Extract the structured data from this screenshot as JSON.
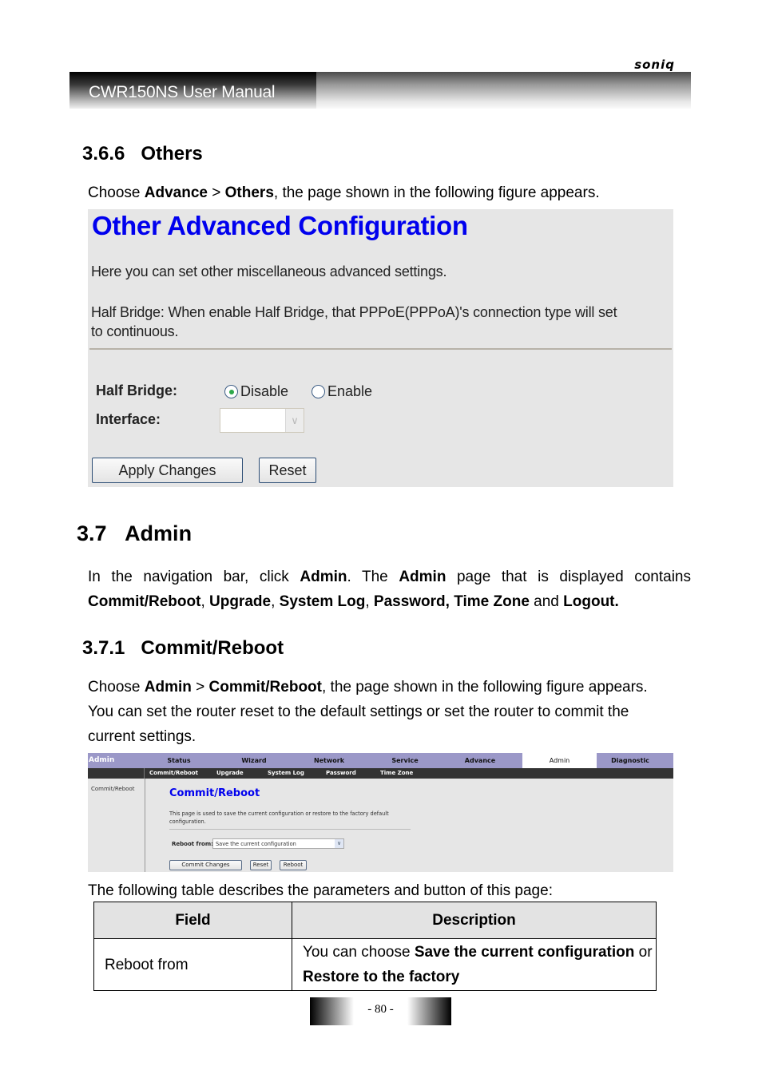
{
  "header": {
    "brand": "soniq",
    "manual_title": "CWR150NS User Manual"
  },
  "section_366": {
    "number": "3.6.6",
    "title": "Others",
    "intro": {
      "pre": "Choose ",
      "b1": "Advance",
      "mid": " > ",
      "b2": "Others",
      "post": ", the page shown in the following figure appears."
    }
  },
  "others_screen": {
    "title": "Other Advanced Configuration",
    "desc1": "Here you can set other miscellaneous advanced settings.",
    "desc2_line1": "Half Bridge: When enable Half Bridge, that PPPoE(PPPoA)'s connection type will set",
    "desc2_line2": "to continuous.",
    "half_bridge_label": "Half Bridge:",
    "half_bridge_options": [
      {
        "label": "Disable",
        "selected": true
      },
      {
        "label": "Enable",
        "selected": false
      }
    ],
    "interface_label": "Interface:",
    "interface_value": "",
    "apply_button": "Apply Changes",
    "reset_button": "Reset"
  },
  "section_37": {
    "number": "3.7",
    "title": "Admin",
    "para": {
      "t1": "In the navigation bar, click ",
      "b1": "Admin",
      "t2": ". The ",
      "b2": "Admin",
      "t3": " page that is displayed contains ",
      "b3": "Commit/Reboot",
      "t4": ", ",
      "b4": "Upgrade",
      "t5": ", ",
      "b5": "System Log",
      "t6": ", ",
      "b6": "Password, Time Zone",
      "t7": " and ",
      "b7": "Logout."
    }
  },
  "section_371": {
    "number": "3.7.1",
    "title": "Commit/Reboot",
    "para": {
      "t1": "Choose ",
      "b1": "Admin",
      "t2": " > ",
      "b2": "Commit/Reboot",
      "t3": ", the page shown in the following figure appears.",
      "line2": "You can set the router reset to the default settings or set the router to commit the",
      "line3": "current settings."
    }
  },
  "commit_screen": {
    "brand": "Admin",
    "nav": [
      "Status",
      "Wizard",
      "Network",
      "Service",
      "Advance",
      "Admin",
      "Diagnostic"
    ],
    "active_nav": "Admin",
    "subnav": [
      "Commit/Reboot",
      "Upgrade",
      "System Log",
      "Password",
      "Time Zone"
    ],
    "sidebar": [
      "Commit/Reboot"
    ],
    "title": "Commit/Reboot",
    "desc": "This page is used to save the current configuration or restore to the factory default configuration.",
    "reboot_label": "Reboot from:",
    "reboot_value": "Save the current configuration",
    "buttons": [
      "Commit Changes",
      "Reset",
      "Reboot"
    ]
  },
  "table_intro": "The following table describes the parameters and button of this page:",
  "params_table": {
    "headers": [
      "Field",
      "Description"
    ],
    "rows": [
      {
        "field": "Reboot from",
        "desc": {
          "t1": "You can choose ",
          "b1": "Save the current configuration",
          "t2": " or ",
          "b2": "Restore to the factory"
        }
      }
    ]
  },
  "footer": {
    "page_number": "- 80 -"
  }
}
